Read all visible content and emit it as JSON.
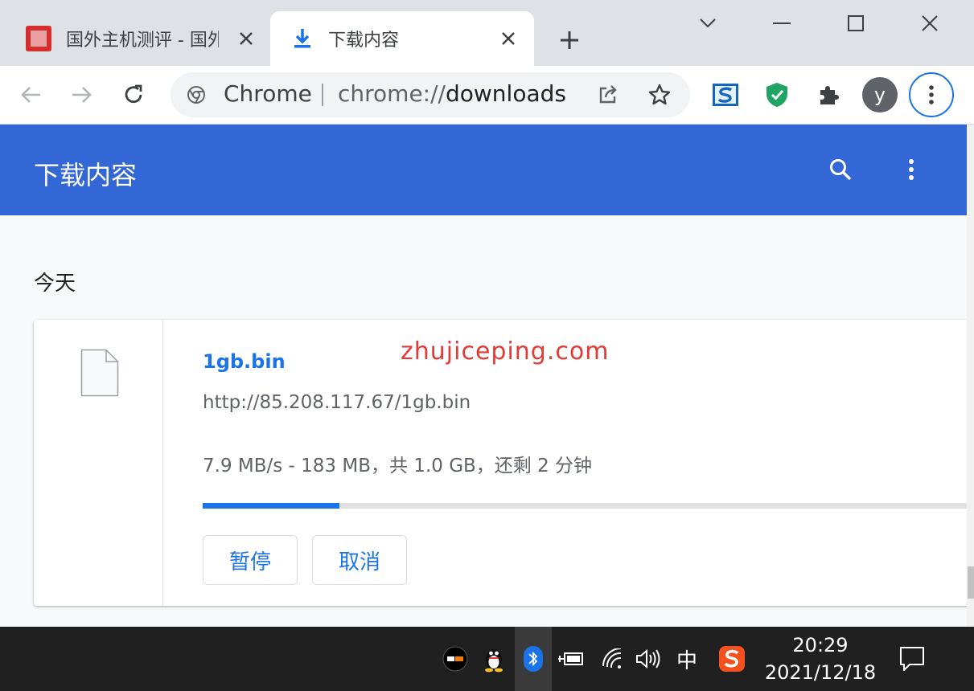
{
  "tabs": [
    {
      "title": "国外主机测评 - 国外"
    },
    {
      "title": "下载内容"
    }
  ],
  "toolbar": {
    "omnibox_origin": "Chrome",
    "omnibox_url_prefix": "chrome://",
    "omnibox_url_path": "downloads",
    "profile_initial": "y"
  },
  "downloads_page": {
    "title": "下载内容",
    "day_label": "今天"
  },
  "download_item": {
    "file_name": "1gb.bin",
    "watermark": "zhujiceping.com",
    "url": "http://85.208.117.67/1gb.bin",
    "status": "7.9 MB/s - 183 MB，共 1.0 GB，还剩 2 分钟",
    "progress_fraction": 0.177,
    "pause_label": "暂停",
    "cancel_label": "取消"
  },
  "taskbar": {
    "ime_mode": "中",
    "time": "20:29",
    "date": "2021/12/18"
  },
  "colors": {
    "header_blue": "#3367d6",
    "link_blue": "#1a73e8",
    "watermark_red": "#e53935"
  }
}
